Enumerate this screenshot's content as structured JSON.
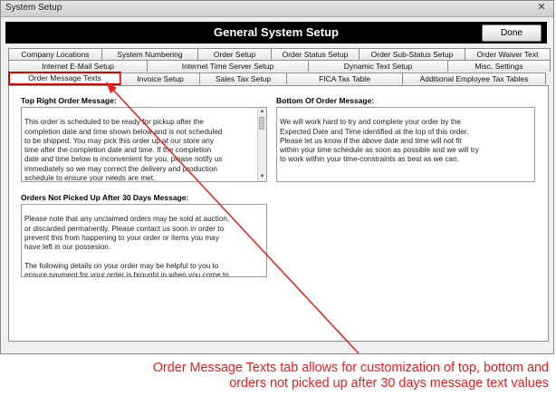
{
  "window": {
    "title": "System Setup",
    "close_symbol": "✕"
  },
  "header": {
    "title": "General System Setup",
    "done_label": "Done"
  },
  "tabs_row1": [
    "Company Locations",
    "System Numbering",
    "Order Setup",
    "Order Status Setup",
    "Order Sub-Status Setup",
    "Order Waiver Text"
  ],
  "tabs_row2": [
    "Internet E-Mail Setup",
    "Internet Time Server Setup",
    "Dynamic Text Setup",
    "Misc. Settings"
  ],
  "tabs_row3": [
    "Order Message Texts",
    "Invoice Setup",
    "Sales Tax Setup",
    "FICA Tax Table",
    "Additional Employee Tax Tables"
  ],
  "active_tab": "Order Message Texts",
  "top_right": {
    "label": "Top Right Order Message:",
    "text": "This order is scheduled to be ready for pickup after the\ncompletion date and time shown below and is not scheduled\nto be shipped.  You may pick this order up at our store any\ntime after the completion date and time.  If the completion\ndate and time below is inconvenient for you, please notify us\nimmediately so we may correct the delivery and production\nschedule to ensure your needs are met."
  },
  "bottom": {
    "label": "Bottom Of Order Message:",
    "text": "We will work hard to try and complete your order by the\nExpected Date and Time identified at the top of this order.\nPlease let us know if the above date and time will not fit\nwithin your time schedule as soon as possible and we will try\nto work within your time-constraints as best as we can."
  },
  "not_picked_up": {
    "label": "Orders Not Picked Up After 30 Days Message:",
    "text": "Please note that any unclaimed orders may be sold at auction,\nor discarded permanently.  Please contact us soon in order to\nprevent this from happening to your order or items you may\nhave left in our possesion.\n\nThe following details on your order may be helpful to you to\nensure payment for your order is brought in when you come to\npick up your order."
  },
  "caption": {
    "line1": "Order Message Texts tab allows for customization of top, bottom and",
    "line2": "orders not picked up after 30 days message text values"
  },
  "colors": {
    "annotation": "#ee1b1b",
    "header_bg": "#000000"
  }
}
